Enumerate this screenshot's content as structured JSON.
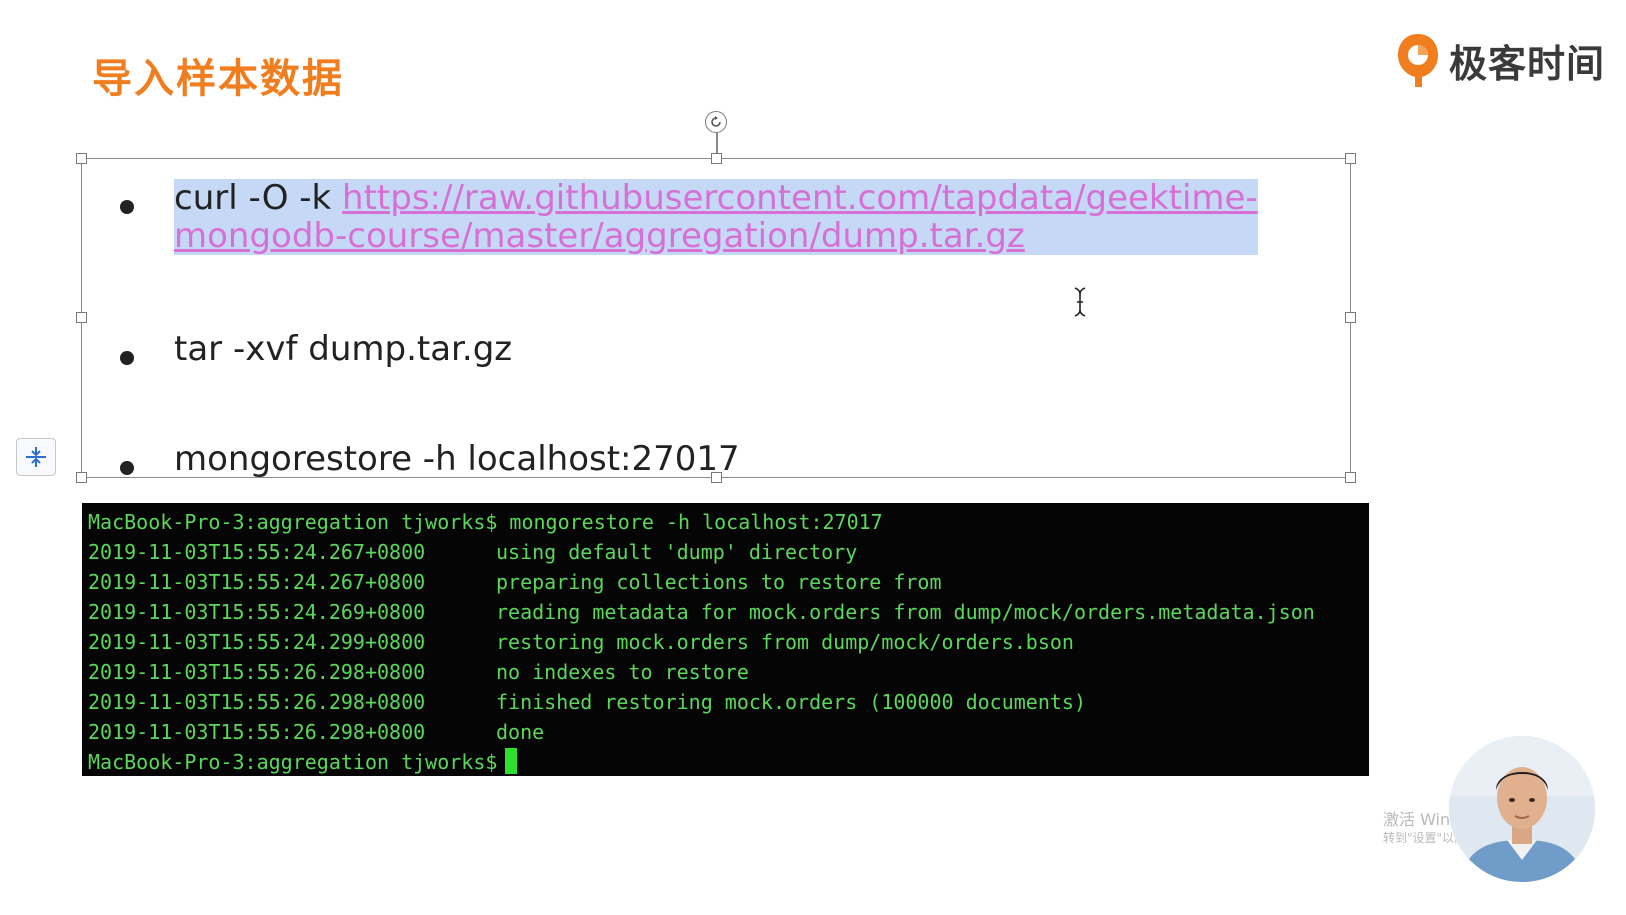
{
  "slide": {
    "title": "导入样本数据",
    "brand_name": "极客时间",
    "bullets": [
      {
        "prefix": "curl -O -k ",
        "link_line1": "https://raw.githubusercontent.com/tapdata/geektime-",
        "link_line2": "mongodb-course/master/aggregation/dump.tar.gz"
      },
      {
        "text": "tar -xvf dump.tar.gz"
      },
      {
        "text": "mongorestore -h localhost:27017"
      }
    ]
  },
  "terminal": {
    "lines": [
      {
        "text": "MacBook-Pro-3:aggregation tjworks$ mongorestore -h localhost:27017"
      },
      {
        "ts": "2019-11-03T15:55:24.267+0800",
        "msg": "using default 'dump' directory"
      },
      {
        "ts": "2019-11-03T15:55:24.267+0800",
        "msg": "preparing collections to restore from"
      },
      {
        "ts": "2019-11-03T15:55:24.269+0800",
        "msg": "reading metadata for mock.orders from dump/mock/orders.metadata.json"
      },
      {
        "ts": "2019-11-03T15:55:24.299+0800",
        "msg": "restoring mock.orders from dump/mock/orders.bson"
      },
      {
        "ts": "2019-11-03T15:55:26.298+0800",
        "msg": "no indexes to restore"
      },
      {
        "ts": "2019-11-03T15:55:26.298+0800",
        "msg": "finished restoring mock.orders (100000 documents)"
      },
      {
        "ts": "2019-11-03T15:55:26.298+0800",
        "msg": "done"
      }
    ],
    "prompt": "MacBook-Pro-3:aggregation tjworks$"
  },
  "watermark": {
    "line1": "激活 Windows",
    "line2": "转到\"设置\"以激活 Windows。"
  },
  "colors": {
    "title": "#f07d1e",
    "link": "#d86fd6",
    "selection": "#c5d9f6",
    "terminal_text": "#5bd85b"
  },
  "icons": {
    "brand": "geektime-logo-icon",
    "rotate": "rotate-icon",
    "side_tool": "vertical-distribute-icon",
    "cursor": "text-cursor-icon"
  }
}
